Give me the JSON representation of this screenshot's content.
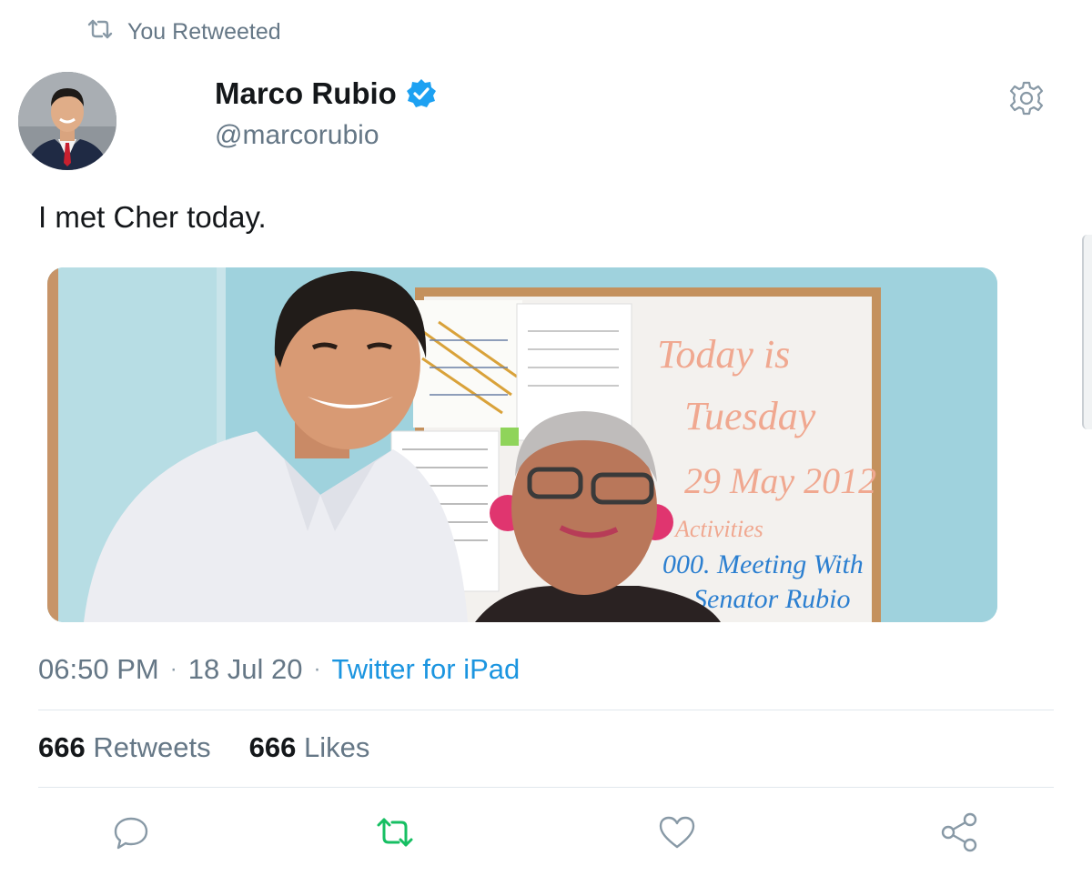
{
  "retweet_banner": {
    "text": "You Retweeted",
    "icon": "retweet-icon"
  },
  "author": {
    "name": "Marco Rubio",
    "handle": "@marcorubio",
    "verified": true,
    "avatar_icon": "avatar"
  },
  "tweet": {
    "text": "I met Cher today.",
    "media": {
      "board_lines": [
        "Today is",
        "Tuesday",
        "29 May 2012",
        "Activities",
        "000. Meeting With",
        "Senator Rubio"
      ]
    }
  },
  "meta": {
    "time": "06:50 PM",
    "date": "18 Jul 20",
    "source": "Twitter for iPad",
    "separator": "·"
  },
  "stats": {
    "retweets_count": "666",
    "retweets_label": "Retweets",
    "likes_count": "666",
    "likes_label": "Likes"
  },
  "actions": [
    "reply-icon",
    "retweet-icon",
    "like-icon",
    "share-icon"
  ],
  "colors": {
    "link": "#1b95e0",
    "secondary_text": "#657786",
    "retweet_active": "#17bf63",
    "verified": "#1da1f2"
  }
}
